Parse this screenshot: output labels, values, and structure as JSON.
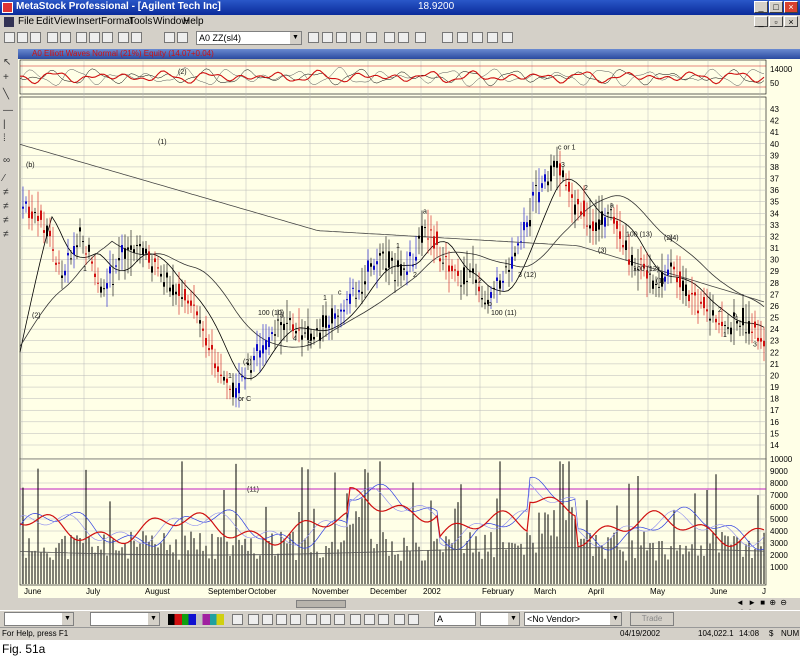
{
  "window": {
    "title": "MetaStock Professional - [Agilent Tech Inc]",
    "center_value": "18.9200"
  },
  "menu": [
    "File",
    "Edit",
    "View",
    "Insert",
    "Format",
    "Tools",
    "Window",
    "Help"
  ],
  "toolbar": {
    "symbol_combo": "A0 ZZ(sl4)"
  },
  "chart": {
    "indicator_title": "A0 Elliott Waves Normal (21%) Equity",
    "indicator_value": "(14.07+0.04)",
    "indicator_scale": [
      "14000",
      "50"
    ],
    "price_axis": [
      "43",
      "42",
      "41",
      "40",
      "39",
      "38",
      "37",
      "36",
      "35",
      "34",
      "33",
      "32",
      "31",
      "30",
      "29",
      "28",
      "27",
      "26",
      "25",
      "24",
      "23",
      "22",
      "21",
      "20",
      "19",
      "18",
      "17",
      "16",
      "15",
      "14"
    ],
    "volume_axis": [
      "10000",
      "9000",
      "8000",
      "7000",
      "6000",
      "5000",
      "4000",
      "3000",
      "2000",
      "1000"
    ],
    "x_axis": [
      "June",
      "July",
      "August",
      "September",
      "October",
      "November",
      "December",
      "2002",
      "February",
      "March",
      "April",
      "May",
      "June",
      "J"
    ],
    "wave_labels": [
      "(1)",
      "(2)",
      "1",
      "2",
      "3",
      "4",
      "5",
      "a",
      "b",
      "c",
      "(5)",
      "100 (10)",
      "100 (11)",
      "100 (12)",
      "101 (11)",
      "(3)",
      "(4)",
      "c or 1",
      "c or C",
      "3",
      "4",
      "(c)",
      "(b)"
    ],
    "colors": {
      "up_bar": "#0a0ac8",
      "down_bar": "#d01010",
      "neutral_bar": "#000000",
      "ma_red": "#d01010",
      "ma_blue": "#3040e0",
      "grid": "#b9b9b9",
      "bg": "#ffffe7"
    }
  },
  "bottom_toolbar": {
    "field_a": "A",
    "vendor": "<No Vendor>",
    "trade": "Trade"
  },
  "status": {
    "help": "For Help, press F1",
    "date": "04/19/2002",
    "coords": "104,022.1",
    "time": "14:08",
    "mode1": "$",
    "mode2": "NUM"
  },
  "caption": "Fig. 51a"
}
